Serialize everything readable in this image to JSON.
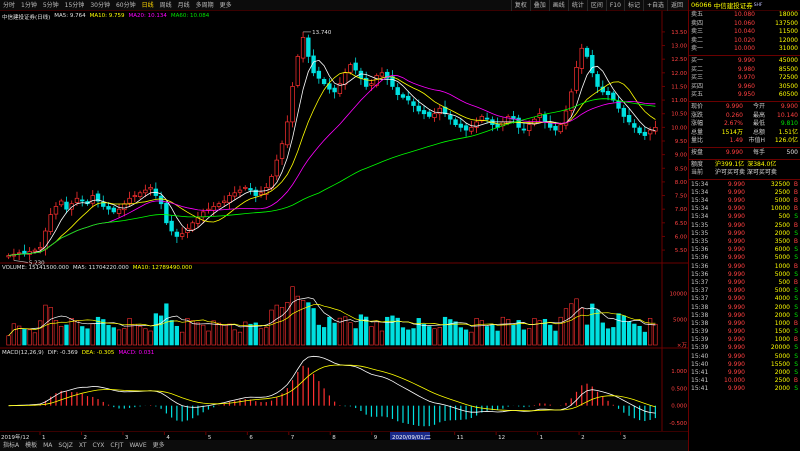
{
  "toolbar": {
    "left_items": [
      "分时",
      "1分钟",
      "5分钟",
      "15分钟",
      "30分钟",
      "60分钟",
      "日线",
      "周线",
      "月线",
      "多周期",
      "更多"
    ],
    "active_index": 6,
    "right_items": [
      "复权",
      "叠加",
      "画线",
      "统计",
      "区间",
      "F10",
      "标记",
      "+自选",
      "返回"
    ]
  },
  "chart_legend": {
    "title": "中信建投证券(日线)",
    "ma5": "MA5: 9.764",
    "ma10": "MA10: 9.759",
    "ma20": "MA20: 10.134",
    "ma60": "MA60: 10.084"
  },
  "price_axis": [
    "13.50",
    "13.00",
    "12.50",
    "12.00",
    "11.50",
    "11.00",
    "10.50",
    "10.00",
    "9.50",
    "9.00",
    "8.50",
    "8.00",
    "7.50",
    "7.00",
    "6.50",
    "6.00",
    "5.50"
  ],
  "price_axis_values": [
    13.5,
    13.0,
    12.5,
    12.0,
    11.5,
    11.0,
    10.5,
    10.0,
    9.5,
    9.0,
    8.5,
    8.0,
    7.5,
    7.0,
    6.5,
    6.0,
    5.5
  ],
  "high_label": "13.740",
  "low_label": "5.230",
  "volume_legend": {
    "vol": "VOLUME: 15141500.000",
    "ma5": "MA5: 11704220.000",
    "ma10": "MA10: 12789490.000"
  },
  "volume_axis": [
    "10000",
    "5000",
    "×万"
  ],
  "volume_axis_values": [
    10000,
    5000
  ],
  "macd_legend": {
    "name": "MACD(12,26,9)",
    "dif": "DIF: -0.369",
    "dea": "DEA: -0.305",
    "macd": "MACD: 0.031"
  },
  "macd_axis": [
    "1.000",
    "0.500",
    "0.000",
    "-0.500"
  ],
  "macd_axis_values": [
    1.0,
    0.5,
    0.0,
    -0.5
  ],
  "date_bar": {
    "start": "2019年/12",
    "months": [
      "1",
      "2",
      "3",
      "4",
      "5",
      "6",
      "7",
      "8",
      "9",
      "10",
      "11",
      "12",
      "1",
      "2",
      "3"
    ],
    "cursor": "2020/09/01/二"
  },
  "bottom_bar": [
    "指标A",
    "模板",
    "MA",
    "SQJZ",
    "XT",
    "CYX",
    "CFJT",
    "WAVE",
    "更多"
  ],
  "stock": {
    "code": "06066",
    "name": "中信建投证券",
    "tag": "SHF"
  },
  "asks": [
    {
      "label": "卖五",
      "price": "10.080",
      "vol": "18000"
    },
    {
      "label": "卖四",
      "price": "10.060",
      "vol": "137500"
    },
    {
      "label": "卖三",
      "price": "10.040",
      "vol": "11500"
    },
    {
      "label": "卖二",
      "price": "10.020",
      "vol": "12000"
    },
    {
      "label": "卖一",
      "price": "10.000",
      "vol": "31000"
    }
  ],
  "bids": [
    {
      "label": "买一",
      "price": "9.990",
      "vol": "45000"
    },
    {
      "label": "买二",
      "price": "9.980",
      "vol": "85500"
    },
    {
      "label": "买三",
      "price": "9.970",
      "vol": "72500"
    },
    {
      "label": "买四",
      "price": "9.960",
      "vol": "30500"
    },
    {
      "label": "买五",
      "price": "9.950",
      "vol": "60500"
    }
  ],
  "stats": [
    {
      "l1": "现价",
      "v1": "9.990",
      "c1": "red",
      "l2": "今开",
      "v2": "9.900",
      "c2": "red"
    },
    {
      "l1": "涨跌",
      "v1": "0.260",
      "c1": "red",
      "l2": "最高",
      "v2": "10.140",
      "c2": "red"
    },
    {
      "l1": "涨幅",
      "v1": "2.67%",
      "c1": "red",
      "l2": "最低",
      "v2": "9.810",
      "c2": "green"
    },
    {
      "l1": "总量",
      "v1": "1514万",
      "c1": "yellow",
      "l2": "总额",
      "v2": "1.51亿",
      "c2": "yellow"
    },
    {
      "l1": "量比",
      "v1": "1.49",
      "c1": "red",
      "l2": "市值H",
      "v2": "126.0亿",
      "c2": "yellow"
    }
  ],
  "extra": [
    {
      "l1": "按盘",
      "v1": "9.990",
      "c1": "red",
      "l2": "每手",
      "v2": "500",
      "c2": "white"
    }
  ],
  "flows": {
    "label1": "额度",
    "hgt": "沪399.1亿",
    "sgt": "深384.0亿",
    "label2": "当前",
    "state": "沪可买可卖 深可买可卖"
  },
  "ticks": [
    {
      "t": "15:34",
      "p": "9.990",
      "v": "32500",
      "d": "B"
    },
    {
      "t": "15:34",
      "p": "9.990",
      "v": "2500",
      "d": "B"
    },
    {
      "t": "15:34",
      "p": "9.990",
      "v": "5000",
      "d": "B"
    },
    {
      "t": "15:34",
      "p": "9.990",
      "v": "10000",
      "d": "B"
    },
    {
      "t": "15:34",
      "p": "9.990",
      "v": "500",
      "d": "S"
    },
    {
      "t": "15:35",
      "p": "9.990",
      "v": "2500",
      "d": "B"
    },
    {
      "t": "15:35",
      "p": "9.990",
      "v": "2000",
      "d": "S"
    },
    {
      "t": "15:35",
      "p": "9.990",
      "v": "3500",
      "d": "B"
    },
    {
      "t": "15:36",
      "p": "9.990",
      "v": "6000",
      "d": "S"
    },
    {
      "t": "15:36",
      "p": "9.990",
      "v": "5000",
      "d": "S"
    },
    {
      "t": "15:36",
      "p": "9.990",
      "v": "1000",
      "d": "B"
    },
    {
      "t": "15:36",
      "p": "9.990",
      "v": "5000",
      "d": "S"
    },
    {
      "t": "15:37",
      "p": "9.990",
      "v": "500",
      "d": "B"
    },
    {
      "t": "15:37",
      "p": "9.990",
      "v": "5000",
      "d": "S"
    },
    {
      "t": "15:37",
      "p": "9.990",
      "v": "4000",
      "d": "S"
    },
    {
      "t": "15:38",
      "p": "9.990",
      "v": "2000",
      "d": "S"
    },
    {
      "t": "15:38",
      "p": "9.990",
      "v": "2000",
      "d": "S"
    },
    {
      "t": "15:38",
      "p": "9.990",
      "v": "1000",
      "d": "B"
    },
    {
      "t": "15:39",
      "p": "9.990",
      "v": "1500",
      "d": "S"
    },
    {
      "t": "15:39",
      "p": "9.990",
      "v": "1000",
      "d": "B"
    },
    {
      "t": "15:39",
      "p": "9.990",
      "v": "20000",
      "d": "S"
    },
    {
      "t": "15:40",
      "p": "9.990",
      "v": "5000",
      "d": "S"
    },
    {
      "t": "15:40",
      "p": "9.990",
      "v": "15500",
      "d": "S"
    },
    {
      "t": "15:41",
      "p": "9.990",
      "v": "2000",
      "d": "S"
    },
    {
      "t": "15:41",
      "p": "10.000",
      "v": "2500",
      "d": "B"
    },
    {
      "t": "15:41",
      "p": "9.990",
      "v": "2000",
      "d": "S"
    }
  ],
  "chart_data": {
    "type": "candlestick",
    "series": [
      {
        "name": "MA5",
        "color": "#ffffff"
      },
      {
        "name": "MA10",
        "color": "#ffff00"
      },
      {
        "name": "MA20",
        "color": "#ff00ff"
      },
      {
        "name": "MA60",
        "color": "#00ff00"
      }
    ],
    "ylim": [
      5.1,
      13.9
    ],
    "close": [
      5.3,
      5.35,
      5.4,
      5.38,
      5.45,
      5.5,
      5.6,
      6.2,
      6.8,
      7.1,
      7.3,
      7.0,
      7.2,
      7.4,
      7.3,
      7.2,
      7.5,
      7.3,
      7.1,
      7.0,
      6.9,
      7.0,
      7.2,
      7.4,
      7.5,
      7.6,
      7.7,
      7.8,
      7.5,
      7.2,
      6.5,
      6.2,
      6.0,
      6.1,
      6.3,
      6.5,
      6.7,
      6.9,
      7.0,
      7.1,
      7.2,
      7.3,
      7.5,
      7.6,
      7.7,
      7.8,
      7.7,
      7.5,
      7.6,
      7.8,
      8.2,
      8.8,
      9.4,
      10.2,
      11.5,
      12.6,
      13.3,
      12.6,
      12.0,
      11.8,
      11.6,
      11.4,
      11.3,
      11.6,
      12.0,
      12.3,
      12.1,
      11.8,
      11.5,
      11.6,
      11.9,
      12.0,
      11.8,
      11.5,
      11.2,
      11.1,
      11.0,
      10.8,
      10.6,
      10.5,
      10.4,
      10.5,
      10.7,
      10.5,
      10.3,
      10.1,
      10.0,
      9.9,
      10.0,
      10.2,
      10.4,
      10.3,
      10.1,
      10.0,
      10.2,
      10.4,
      10.3,
      10.0,
      9.9,
      10.1,
      10.3,
      10.5,
      10.2,
      10.0,
      9.9,
      10.1,
      10.6,
      11.3,
      12.2,
      12.9,
      12.6,
      12.0,
      11.5,
      11.3,
      11.2,
      11.0,
      10.7,
      10.4,
      10.2,
      10.0,
      9.8,
      9.7,
      9.9,
      10.0
    ]
  }
}
